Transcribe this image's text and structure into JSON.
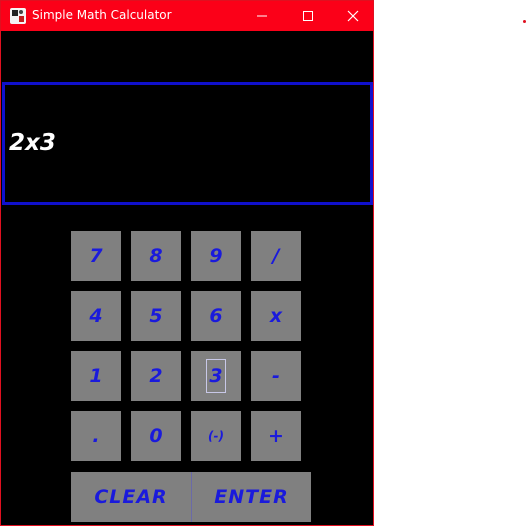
{
  "window": {
    "title": "Simple Math Calculator",
    "minimize_icon": "minimize-icon",
    "maximize_icon": "maximize-icon",
    "close_icon": "close-icon"
  },
  "display": {
    "value": "2x3"
  },
  "keys": {
    "row1": [
      "7",
      "8",
      "9",
      "/"
    ],
    "row2": [
      "4",
      "5",
      "6",
      "x"
    ],
    "row3": [
      "1",
      "2",
      "3",
      "-"
    ],
    "row4": [
      ".",
      "0",
      "(-)",
      "+"
    ]
  },
  "actions": {
    "clear": "CLEAR",
    "enter": "ENTER"
  },
  "colors": {
    "titlebar": "#fb0018",
    "display_border": "#1010cc",
    "key_face": "#808080",
    "key_text": "#1a1adc"
  }
}
